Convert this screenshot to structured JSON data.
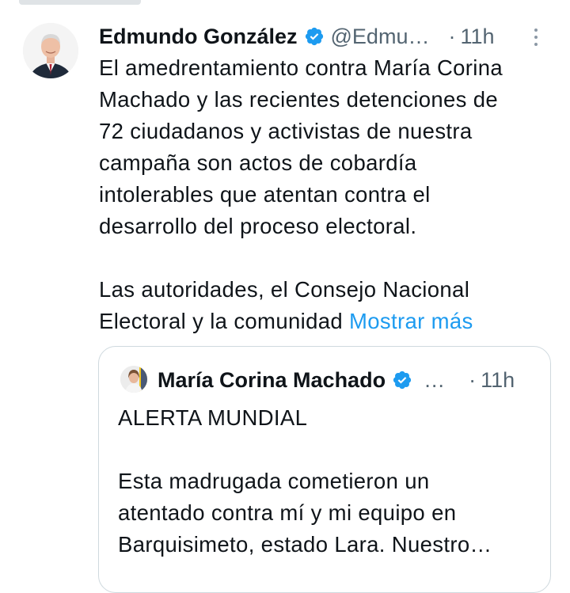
{
  "tweet": {
    "author_name": "Edmundo González",
    "handle": "@Edmu…",
    "separator": "·",
    "time": "11h",
    "avatar_icon": "avatar-photo",
    "verified_icon": "verified-badge-icon",
    "more_icon": "more-vertical-icon",
    "verified_color": "#1d9bf0",
    "text_lines": [
      "El amedrentamiento contra María Corina",
      "Machado y las recientes detenciones de",
      "72 ciudadanos y activistas de nuestra",
      "campaña son actos de cobardía",
      "intolerables que atentan contra el",
      "desarrollo del proceso electoral."
    ],
    "text_lines_2": [
      "Las autoridades, el Consejo Nacional",
      "Electoral y la comunidad"
    ],
    "show_more": "Mostrar más",
    "link_color": "#1d9bf0"
  },
  "quote": {
    "author_name": "María Corina Machado",
    "ellipsis": "…",
    "separator": "·",
    "time": "11h",
    "avatar_icon": "avatar-photo",
    "verified_icon": "verified-badge-icon",
    "text_lines": [
      "ALERTA MUNDIAL",
      "",
      "Esta madrugada cometieron un",
      "atentado contra mí y mi equipo en",
      "Barquisimeto, estado Lara. Nuestro…"
    ]
  }
}
